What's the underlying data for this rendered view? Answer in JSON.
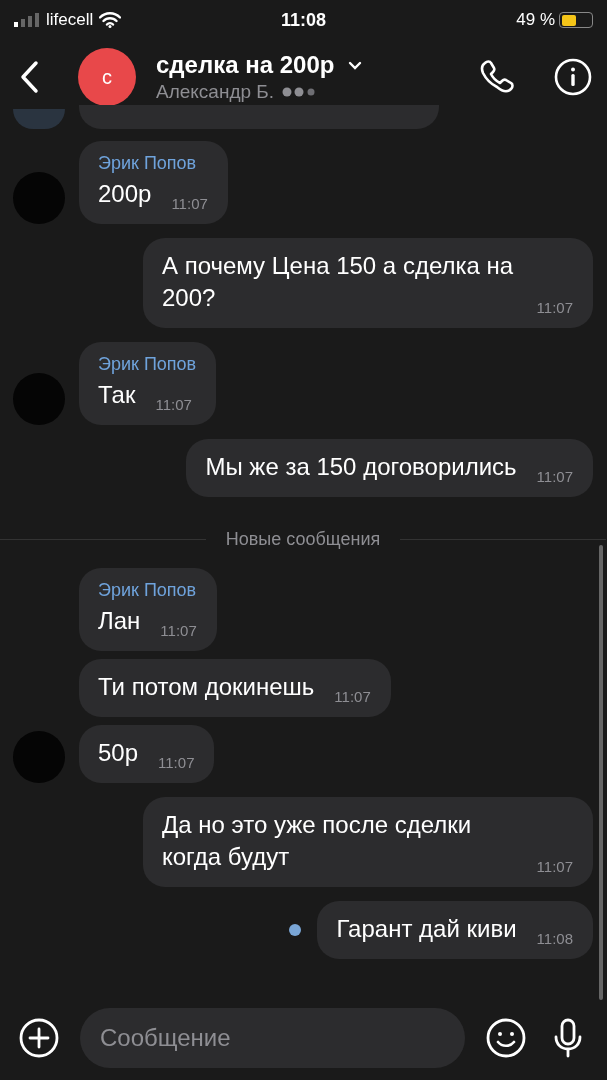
{
  "status_bar": {
    "carrier": "lifecell",
    "time": "11:08",
    "battery": "49 %"
  },
  "header": {
    "avatar_letter": "с",
    "title": "сделка на 200р",
    "subtitle": "Александр Б."
  },
  "messages": [
    {
      "kind": "cut"
    },
    {
      "kind": "incoming",
      "sender": "Эрик Попов",
      "text": "200р",
      "time": "11:07",
      "avatar": true
    },
    {
      "kind": "outgoing",
      "text": "А почему Цена 150 а сделка на 200?",
      "time": "11:07",
      "unread": false
    },
    {
      "kind": "incoming",
      "sender": "Эрик Попов",
      "text": "Так",
      "time": "11:07",
      "avatar": true
    },
    {
      "kind": "outgoing",
      "text": "Мы же за 150 договорились",
      "time": "11:07",
      "unread": false
    },
    {
      "kind": "divider",
      "text": "Новые сообщения"
    },
    {
      "kind": "incoming",
      "sender": "Эрик Попов",
      "text": "Лан",
      "time": "11:07",
      "avatar": false
    },
    {
      "kind": "incoming",
      "text": "Ти потом докинешь",
      "time": "11:07",
      "avatar": false
    },
    {
      "kind": "incoming",
      "text": "50р",
      "time": "11:07",
      "avatar": true
    },
    {
      "kind": "outgoing",
      "text": "Да но это уже после сделки когда будут",
      "time": "11:07",
      "unread": false
    },
    {
      "kind": "outgoing",
      "text": "Гарант дай киви",
      "time": "11:08",
      "unread": true
    }
  ],
  "composer": {
    "placeholder": "Сообщение"
  }
}
